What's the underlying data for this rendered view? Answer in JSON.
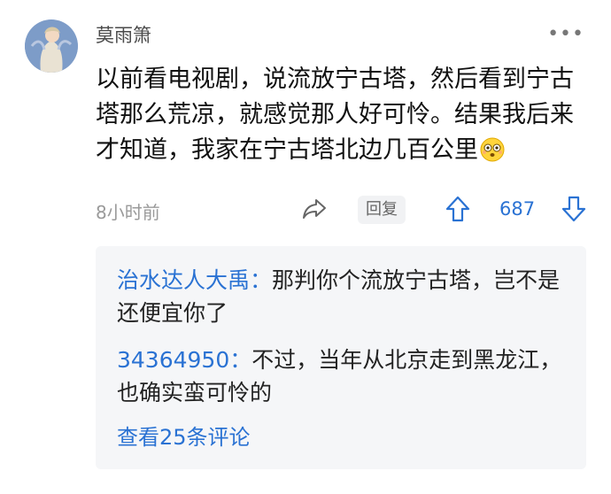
{
  "comment": {
    "username": "莫雨箫",
    "text": "以前看电视剧，说流放宁古塔，然后看到宁古塔那么荒凉，就感觉那人好可怜。结果我后来才知道，我家在宁古塔北边几百公里",
    "emoji": "flushed-face-emoji",
    "time": "8小时前",
    "reply_label": "回复",
    "vote_count": "687",
    "more_icon": "more-dots-icon"
  },
  "replies": [
    {
      "name": "治水达人大禹",
      "separator": "：",
      "text": "那判你个流放宁古塔，岂不是还便宜你了"
    },
    {
      "name": "34364950",
      "separator": "：",
      "text": "不过，当年从北京走到黑龙江，也确实蛮可怜的"
    }
  ],
  "view_more": "查看25条评论",
  "colors": {
    "accent": "#2a72d3",
    "muted": "#9a9a9a",
    "reply_bg": "#f5f6f8"
  }
}
